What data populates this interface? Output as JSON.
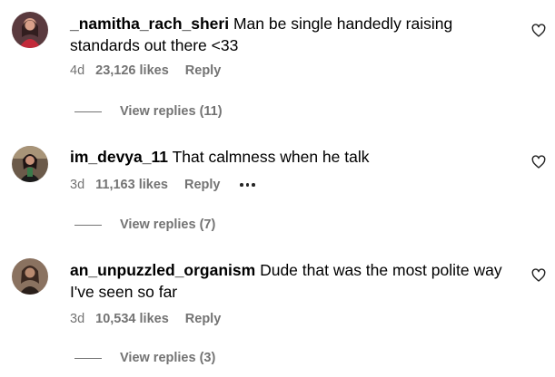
{
  "colors": {
    "text_primary": "#000000",
    "text_secondary": "#737373"
  },
  "comments": [
    {
      "username": "_namitha_rach_sheri",
      "text": "Man be single handedly raising standards out there <33",
      "time": "4d",
      "likes": "23,126 likes",
      "reply_label": "Reply",
      "view_replies": "View replies (11)",
      "show_more": false,
      "avatar_icon": "profile-avatar"
    },
    {
      "username": "im_devya_11",
      "text": "That calmness when he talk",
      "time": "3d",
      "likes": "11,163 likes",
      "reply_label": "Reply",
      "view_replies": "View replies (7)",
      "show_more": true,
      "avatar_icon": "profile-avatar"
    },
    {
      "username": "an_unpuzzled_organism",
      "text": "Dude that was the most polite way I've seen so far",
      "time": "3d",
      "likes": "10,534 likes",
      "reply_label": "Reply",
      "view_replies": "View replies (3)",
      "show_more": false,
      "avatar_icon": "profile-avatar"
    }
  ]
}
